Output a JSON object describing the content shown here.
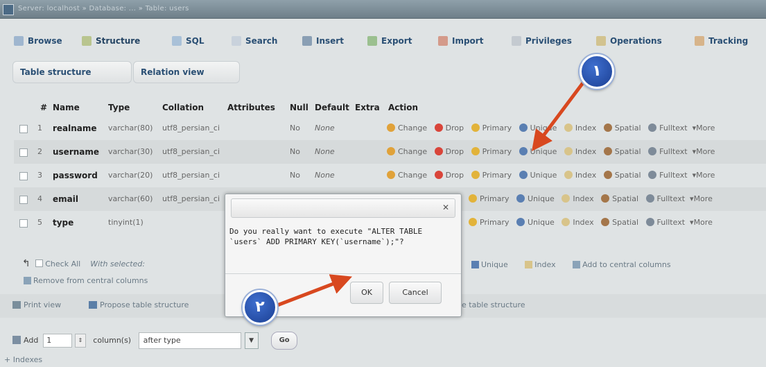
{
  "window": {
    "crumb": "Server: localhost » Database: ... » Table: users"
  },
  "tabs": [
    "Browse",
    "Structure",
    "SQL",
    "Search",
    "Insert",
    "Export",
    "Import",
    "Privileges",
    "Operations",
    "Tracking"
  ],
  "subtabs": [
    "Table structure",
    "Relation view"
  ],
  "columns": [
    "#",
    "Name",
    "Type",
    "Collation",
    "Attributes",
    "Null",
    "Default",
    "Extra",
    "Action"
  ],
  "rows": [
    {
      "num": "1",
      "name": "realname",
      "type": "varchar(80)",
      "collation": "utf8_persian_ci",
      "null": "No",
      "default": "None"
    },
    {
      "num": "2",
      "name": "username",
      "type": "varchar(30)",
      "collation": "utf8_persian_ci",
      "null": "No",
      "default": "None"
    },
    {
      "num": "3",
      "name": "password",
      "type": "varchar(20)",
      "collation": "utf8_persian_ci",
      "null": "No",
      "default": "None"
    },
    {
      "num": "4",
      "name": "email",
      "type": "varchar(60)",
      "collation": "utf8_persian_ci",
      "null": "",
      "default": ""
    },
    {
      "num": "5",
      "name": "type",
      "type": "tinyint(1)",
      "collation": "",
      "null": "",
      "default": ""
    }
  ],
  "actions": {
    "change": "Change",
    "drop": "Drop",
    "primary": "Primary",
    "unique": "Unique",
    "index": "Index",
    "spatial": "Spatial",
    "fulltext": "Fulltext",
    "more": "More"
  },
  "below": {
    "check_all": "Check All",
    "with_selected": "With selected:",
    "unique": "Unique",
    "index": "Index",
    "add_central": "Add to central columns",
    "remove_central": "Remove from central columns",
    "print_view": "Print view",
    "propose": "Propose table structure",
    "move_structure": "e table structure",
    "add": "Add",
    "add_count": "1",
    "columns": "column(s)",
    "after": "after type",
    "go": "Go",
    "indexes": "+ Indexes"
  },
  "dialog": {
    "message": "Do you really want to execute \"ALTER TABLE `users` ADD PRIMARY KEY(`username`);\"?",
    "ok": "OK",
    "cancel": "Cancel"
  },
  "badges": {
    "one": "١",
    "two": "٢"
  },
  "colors": {
    "arrow": "#d8481f",
    "badge": "#2a53b4",
    "link": "#2a4f74"
  }
}
